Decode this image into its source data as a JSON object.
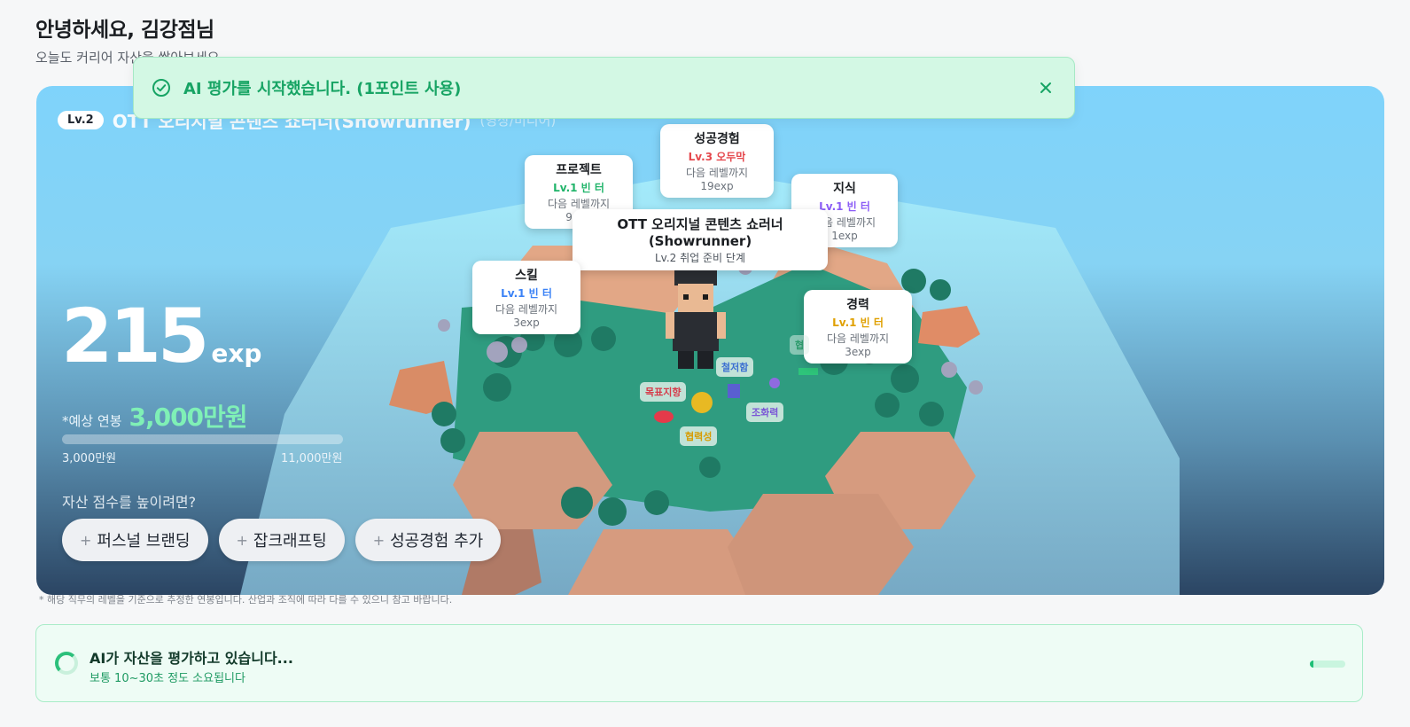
{
  "header": {
    "greeting": "안녕하세요, 김강점님",
    "subtitle": "오늘도 커리어 자산을 쌓아보세요"
  },
  "hero": {
    "level_badge": "Lv.2",
    "job_title": "OTT 오리지널 콘텐츠 쇼러너(Showrunner)",
    "job_title_sub": "(영상/미디어)",
    "exp_value": "215",
    "exp_unit": "exp",
    "salary_label": "*예상 연봉",
    "salary_value": "3,000만원",
    "salary_min": "3,000만원",
    "salary_max": "11,000만원",
    "salary_progress_fraction": 0.0,
    "improve_question": "자산 점수를 높이려면?",
    "chips": [
      {
        "plus": "+",
        "label": "퍼스널 브랜딩"
      },
      {
        "plus": "+",
        "label": "잡크래프팅"
      },
      {
        "plus": "+",
        "label": "성공경험 추가"
      }
    ]
  },
  "island_cards": {
    "success": {
      "title": "성공경험",
      "level": "Lv.3 오두막",
      "next": "다음 레벨까지 19exp",
      "color": "#e5484d"
    },
    "project": {
      "title": "프로젝트",
      "level": "Lv.1 빈 터",
      "next": "다음 레벨까지 9exp",
      "color": "#20b46a"
    },
    "knowledge": {
      "title": "지식",
      "level": "Lv.1 빈 터",
      "next": "다음 레벨까지 1exp",
      "color": "#8b5cf6"
    },
    "skill": {
      "title": "스킬",
      "level": "Lv.1 빈 터",
      "next": "다음 레벨까지 3exp",
      "color": "#3b82f6"
    },
    "career": {
      "title": "경력",
      "level": "Lv.1 빈 터",
      "next": "다음 레벨까지 3exp",
      "color": "#e0a000"
    },
    "main": {
      "title": "OTT 오리지널 콘텐츠 쇼러너(Showrunner)",
      "subtitle": "Lv.2 취업 준비 단계"
    }
  },
  "island_tags": {
    "goal": "목표지향",
    "thorough": "철저함",
    "harmony": "조화력",
    "partial1": "협",
    "bottom": "협력성"
  },
  "toast": {
    "message": "AI 평가를 시작했습니다. (1포인트 사용)",
    "icon": "check-circle-icon",
    "close_icon": "close-icon"
  },
  "disclaimer": "* 해당 직무의 레벨을 기준으로 추정한 연봉입니다. 산업과 조직에 따라 다를 수 있으니 참고 바랍니다.",
  "loading": {
    "title": "AI가 자산을 평가하고 있습니다...",
    "subtitle": "보통 10~30초 정도 소요됩니다",
    "progress_fraction": 0.1
  },
  "colors": {
    "accent_green": "#17a464",
    "salary_green": "#7ff0b6"
  }
}
